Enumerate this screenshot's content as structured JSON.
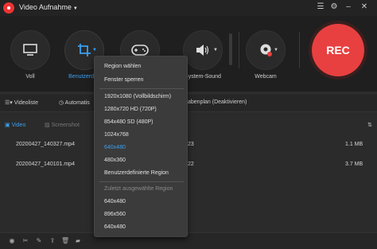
{
  "titlebar": {
    "title": "Video Aufnahme",
    "icons": [
      "list-icon",
      "gear-icon",
      "minimize-icon",
      "close-icon"
    ]
  },
  "tools": [
    {
      "label": "Voll",
      "icon": "monitor-icon"
    },
    {
      "label": "Benutzerdef.",
      "icon": "crop-icon",
      "active": true
    },
    {
      "label": "",
      "icon": "gamepad-icon"
    },
    {
      "label": "System-Sound",
      "icon": "speaker-icon"
    },
    {
      "label": "Webcam",
      "icon": "webcam-icon"
    }
  ],
  "rec_label": "REC",
  "options": {
    "videoliste": "Videoliste",
    "automatic": "Automatis",
    "schedule": "abenplan (Deaktivieren)"
  },
  "file_tabs": {
    "video": "Video",
    "screenshot": "Screenshot"
  },
  "files": [
    {
      "name": "20200427_140327.mp4",
      "duration": "23",
      "size": "1.1 MB"
    },
    {
      "name": "20200427_140101.mp4",
      "duration": "22",
      "size": "3.7 MB"
    }
  ],
  "dropdown": {
    "region_select": "Region wählen",
    "lock_window": "Fenster sperren",
    "res1": "1920x1080 (Vollbildschirm)",
    "res2": "1280x720 HD (720P)",
    "res3": "854x480 SD (480P)",
    "res4": "1024x768",
    "res5": "640x480",
    "res6": "480x360",
    "custom_region": "Benutzerdefinierte Region",
    "recent_header": "Zuletzt ausgewählte Region",
    "recent1": "640x480",
    "recent2": "896x560",
    "recent3": "640x480"
  },
  "colors": {
    "accent": "#3aa0f0",
    "rec": "#e84040"
  }
}
